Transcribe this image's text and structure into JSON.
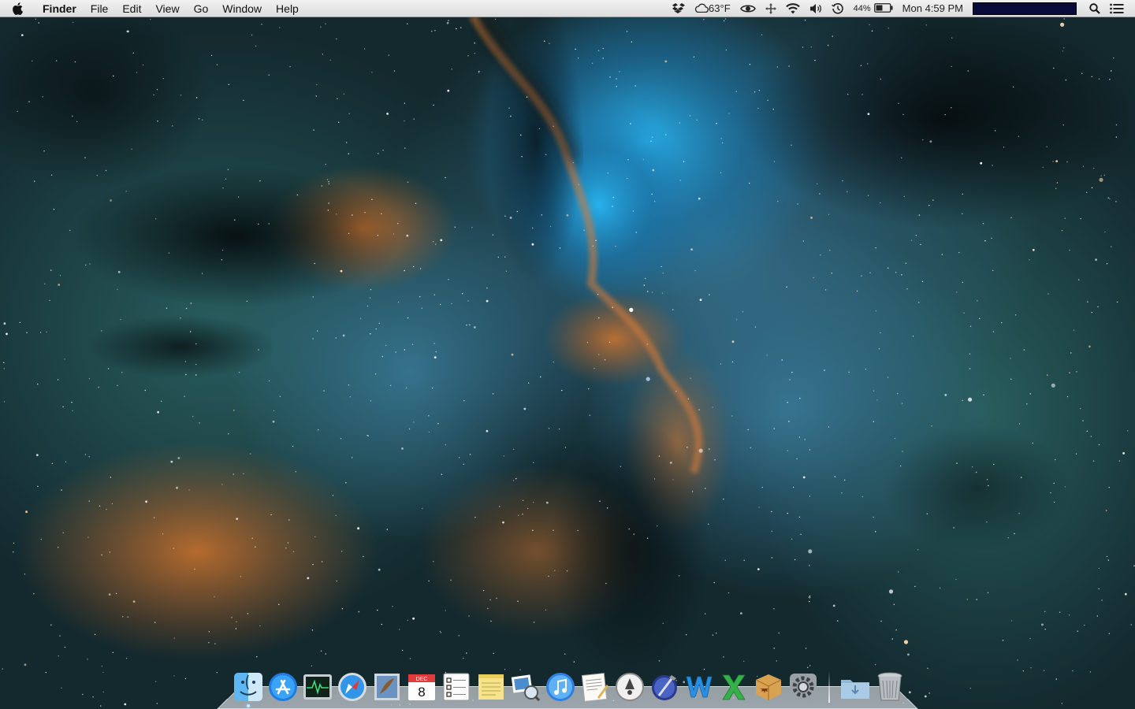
{
  "menubar": {
    "app_name": "Finder",
    "menus": [
      "File",
      "Edit",
      "View",
      "Go",
      "Window",
      "Help"
    ],
    "status": {
      "weather": "63°F",
      "battery_percent": "44%",
      "clock": "Mon 4:59 PM"
    }
  },
  "dock": {
    "items": [
      {
        "name": "Finder",
        "icon": "finder-icon"
      },
      {
        "name": "App Store",
        "icon": "app-store-icon"
      },
      {
        "name": "Activity Monitor",
        "icon": "activity-monitor-icon"
      },
      {
        "name": "Safari",
        "icon": "safari-icon"
      },
      {
        "name": "Mail",
        "icon": "mail-icon"
      },
      {
        "name": "Calendar",
        "icon": "calendar-icon",
        "label_month": "DEC",
        "label_day": "8"
      },
      {
        "name": "Reminders",
        "icon": "reminders-icon"
      },
      {
        "name": "Stickies",
        "icon": "stickies-icon"
      },
      {
        "name": "Preview",
        "icon": "preview-icon"
      },
      {
        "name": "iTunes",
        "icon": "itunes-icon"
      },
      {
        "name": "TextEdit",
        "icon": "textedit-icon"
      },
      {
        "name": "Script Editor",
        "icon": "script-editor-icon"
      },
      {
        "name": "Xcode",
        "icon": "xcode-icon"
      },
      {
        "name": "Word",
        "icon": "word-icon"
      },
      {
        "name": "Excel",
        "icon": "excel-icon"
      },
      {
        "name": "Archive Utility",
        "icon": "archive-icon"
      },
      {
        "name": "System Preferences",
        "icon": "system-preferences-icon"
      },
      {
        "name": "Downloads",
        "icon": "downloads-folder-icon"
      },
      {
        "name": "Trash",
        "icon": "trash-icon"
      }
    ]
  },
  "colors": {
    "menubar_bg": "#e6e6e6",
    "nebula_blue": "#1f8fd0",
    "nebula_orange": "#c8692a",
    "space_dark": "#0d1c22"
  }
}
